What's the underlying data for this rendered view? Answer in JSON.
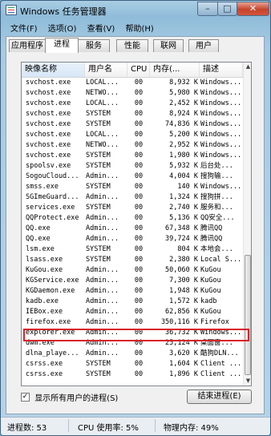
{
  "window": {
    "title": "Windows 任务管理器",
    "min": "–",
    "max": "□",
    "close": "✕"
  },
  "menu": [
    "文件(F)",
    "选项(O)",
    "查看(V)",
    "帮助(H)"
  ],
  "tabs": [
    "应用程序",
    "进程",
    "服务",
    "性能",
    "联网",
    "用户"
  ],
  "active_tab": "进程",
  "columns": {
    "name": "映像名称",
    "user": "用户名",
    "cpu": "CPU",
    "mem": "内存(...",
    "desc": "描述"
  },
  "rows": [
    {
      "name": "svchost.exe",
      "user": "LOCAL...",
      "cpu": "00",
      "mem": "8,932 K",
      "desc": "Windows..."
    },
    {
      "name": "svchost.exe",
      "user": "NETWO...",
      "cpu": "00",
      "mem": "5,980 K",
      "desc": "Windows..."
    },
    {
      "name": "svchost.exe",
      "user": "LOCAL...",
      "cpu": "00",
      "mem": "2,452 K",
      "desc": "Windows..."
    },
    {
      "name": "svchost.exe",
      "user": "SYSTEM",
      "cpu": "00",
      "mem": "8,924 K",
      "desc": "Windows..."
    },
    {
      "name": "svchost.exe",
      "user": "SYSTEM",
      "cpu": "00",
      "mem": "74,836 K",
      "desc": "Windows..."
    },
    {
      "name": "svchost.exe",
      "user": "LOCAL...",
      "cpu": "00",
      "mem": "5,200 K",
      "desc": "Windows..."
    },
    {
      "name": "svchost.exe",
      "user": "NETWO...",
      "cpu": "00",
      "mem": "2,952 K",
      "desc": "Windows..."
    },
    {
      "name": "svchost.exe",
      "user": "SYSTEM",
      "cpu": "00",
      "mem": "1,980 K",
      "desc": "Windows..."
    },
    {
      "name": "spoolsv.exe",
      "user": "SYSTEM",
      "cpu": "00",
      "mem": "5,932 K",
      "desc": "后台处..."
    },
    {
      "name": "SogouCloud...",
      "user": "Admin...",
      "cpu": "00",
      "mem": "4,004 K",
      "desc": "搜狗输..."
    },
    {
      "name": "smss.exe",
      "user": "SYSTEM",
      "cpu": "00",
      "mem": "140 K",
      "desc": "Windows..."
    },
    {
      "name": "SGImeGuard...",
      "user": "Admin...",
      "cpu": "00",
      "mem": "1,324 K",
      "desc": "搜狗拼..."
    },
    {
      "name": "services.exe",
      "user": "SYSTEM",
      "cpu": "00",
      "mem": "2,740 K",
      "desc": "服务和..."
    },
    {
      "name": "QQProtect.exe",
      "user": "Admin...",
      "cpu": "00",
      "mem": "5,136 K",
      "desc": "QQ安全..."
    },
    {
      "name": "QQ.exe",
      "user": "Admin...",
      "cpu": "00",
      "mem": "67,348 K",
      "desc": "腾讯QQ"
    },
    {
      "name": "QQ.exe",
      "user": "Admin...",
      "cpu": "00",
      "mem": "39,724 K",
      "desc": "腾讯QQ"
    },
    {
      "name": "lsm.exe",
      "user": "SYSTEM",
      "cpu": "00",
      "mem": "804 K",
      "desc": "本地会..."
    },
    {
      "name": "lsass.exe",
      "user": "SYSTEM",
      "cpu": "00",
      "mem": "2,380 K",
      "desc": "Local S..."
    },
    {
      "name": "KuGou.exe",
      "user": "Admin...",
      "cpu": "00",
      "mem": "50,060 K",
      "desc": "KuGou"
    },
    {
      "name": "KGService.exe",
      "user": "Admin...",
      "cpu": "00",
      "mem": "7,300 K",
      "desc": "KuGou"
    },
    {
      "name": "KGDaemon.exe",
      "user": "Admin...",
      "cpu": "00",
      "mem": "1,948 K",
      "desc": "KuGou"
    },
    {
      "name": "kadb.exe",
      "user": "Admin...",
      "cpu": "00",
      "mem": "1,572 K",
      "desc": "kadb"
    },
    {
      "name": "IEBox.exe",
      "user": "Admin...",
      "cpu": "00",
      "mem": "62,856 K",
      "desc": "KuGou"
    },
    {
      "name": "firefox.exe",
      "user": "Admin...",
      "cpu": "00",
      "mem": "350,116 K",
      "desc": "Firefox"
    },
    {
      "name": "explorer.exe",
      "user": "Admin...",
      "cpu": "00",
      "mem": "36,732 K",
      "desc": "Windows..."
    },
    {
      "name": "dwm.exe",
      "user": "Admin...",
      "cpu": "00",
      "mem": "25,124 K",
      "desc": "桌面窗..."
    },
    {
      "name": "dlna_playe...",
      "user": "Admin...",
      "cpu": "00",
      "mem": "3,620 K",
      "desc": "酷狗DLN..."
    },
    {
      "name": "csrss.exe",
      "user": "SYSTEM",
      "cpu": "00",
      "mem": "1,604 K",
      "desc": "Client ..."
    },
    {
      "name": "csrss.exe",
      "user": "SYSTEM",
      "cpu": "00",
      "mem": "1,896 K",
      "desc": "Client ..."
    }
  ],
  "show_all_users": {
    "label": "显示所有用户的进程(S)",
    "checked": "✓"
  },
  "end_process_button": "结束进程(E)",
  "status": {
    "processes": "进程数: 53",
    "cpu": "CPU 使用率: 5%",
    "memory": "物理内存: 49%"
  },
  "colors": {
    "highlight_box": "#d8242a"
  }
}
